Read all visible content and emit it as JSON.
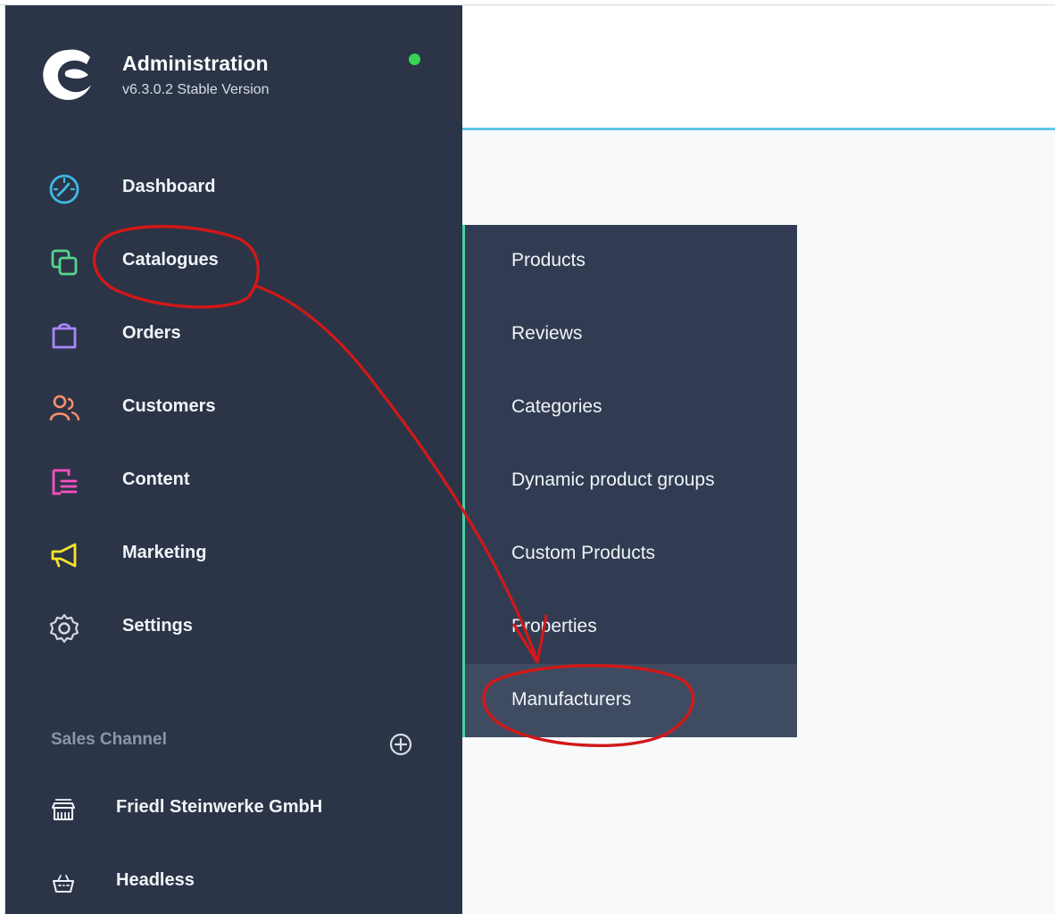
{
  "brand": {
    "title": "Administration",
    "version": "v6.3.0.2 Stable Version",
    "status_color": "#39d353",
    "logo_icon": "shopware-logo-icon"
  },
  "nav": {
    "items": [
      {
        "label": "Dashboard",
        "icon": "dashboard-icon",
        "color": "#3fb9e5"
      },
      {
        "label": "Catalogues",
        "icon": "catalogues-icon",
        "color": "#57d48c"
      },
      {
        "label": "Orders",
        "icon": "orders-icon",
        "color": "#a987ff"
      },
      {
        "label": "Customers",
        "icon": "customers-icon",
        "color": "#ff8f6b"
      },
      {
        "label": "Content",
        "icon": "content-icon",
        "color": "#ff4fc1"
      },
      {
        "label": "Marketing",
        "icon": "marketing-icon",
        "color": "#f7e32d"
      },
      {
        "label": "Settings",
        "icon": "settings-icon",
        "color": "#d3d8df"
      }
    ]
  },
  "sales_channel": {
    "section_title": "Sales Channel",
    "add_icon": "plus-circle-icon",
    "items": [
      {
        "label": "Friedl Steinwerke GmbH",
        "icon": "storefront-icon"
      },
      {
        "label": "Headless",
        "icon": "basket-icon"
      }
    ]
  },
  "submenu": {
    "items": [
      {
        "label": "Products"
      },
      {
        "label": "Reviews"
      },
      {
        "label": "Categories"
      },
      {
        "label": "Dynamic product groups"
      },
      {
        "label": "Custom Products"
      },
      {
        "label": "Properties"
      },
      {
        "label": "Manufacturers"
      }
    ]
  },
  "colors": {
    "sidebar_bg": "#2b3547",
    "submenu_bg": "#313c52",
    "submenu_active": "#3f4b61",
    "submenu_border": "#44d2a4",
    "header_accent": "#5ec9e5",
    "annotation_red": "#d21818"
  }
}
